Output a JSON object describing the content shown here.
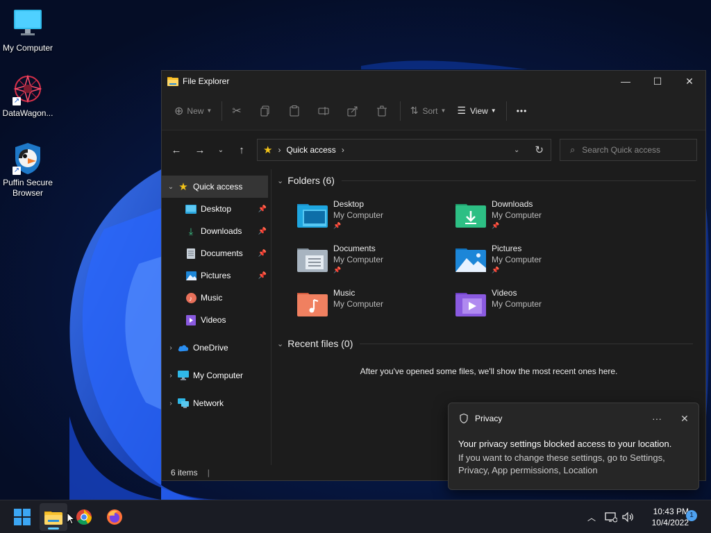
{
  "desktop": {
    "icons": [
      {
        "label": "My Computer",
        "icon": "monitor-icon"
      },
      {
        "label": "DataWagon...",
        "icon": "datawagon-icon"
      },
      {
        "label": "Puffin Secure Browser",
        "icon": "puffin-icon"
      }
    ]
  },
  "window": {
    "title": "File Explorer",
    "controls": {
      "minimize": "—",
      "maximize": "☐",
      "close": "✕"
    },
    "toolbar": {
      "new_label": "New",
      "sort_label": "Sort",
      "view_label": "View",
      "more_label": "•••"
    },
    "address": {
      "path": "Quick access",
      "search_placeholder": "Search Quick access"
    },
    "sidebar": {
      "items": [
        {
          "label": "Quick access",
          "icon": "star-icon",
          "pinned": false
        },
        {
          "label": "Desktop",
          "icon": "desktop-folder-icon",
          "pinned": true
        },
        {
          "label": "Downloads",
          "icon": "download-icon",
          "pinned": true
        },
        {
          "label": "Documents",
          "icon": "documents-icon",
          "pinned": true
        },
        {
          "label": "Pictures",
          "icon": "pictures-icon",
          "pinned": true
        },
        {
          "label": "Music",
          "icon": "music-icon",
          "pinned": false
        },
        {
          "label": "Videos",
          "icon": "videos-icon",
          "pinned": false
        },
        {
          "label": "OneDrive",
          "icon": "cloud-icon",
          "pinned": false
        },
        {
          "label": "My Computer",
          "icon": "monitor-icon",
          "pinned": false
        },
        {
          "label": "Network",
          "icon": "network-icon",
          "pinned": false
        }
      ]
    },
    "folders_header": "Folders (6)",
    "folders": [
      {
        "name": "Desktop",
        "location": "My Computer",
        "pinned": true,
        "icon": "desktop-folder-icon"
      },
      {
        "name": "Downloads",
        "location": "My Computer",
        "pinned": true,
        "icon": "downloads-folder-icon"
      },
      {
        "name": "Documents",
        "location": "My Computer",
        "pinned": true,
        "icon": "documents-folder-icon"
      },
      {
        "name": "Pictures",
        "location": "My Computer",
        "pinned": true,
        "icon": "pictures-folder-icon"
      },
      {
        "name": "Music",
        "location": "My Computer",
        "pinned": false,
        "icon": "music-folder-icon"
      },
      {
        "name": "Videos",
        "location": "My Computer",
        "pinned": false,
        "icon": "videos-folder-icon"
      }
    ],
    "recent_header": "Recent files (0)",
    "recent_empty": "After you've opened some files, we'll show the most recent ones here.",
    "status": "6 items"
  },
  "toast": {
    "title": "Privacy",
    "more": "···",
    "close": "✕",
    "message": "Your privacy settings blocked access to your location.",
    "detail": "If you want to change these settings, go to Settings, Privacy, App permissions, Location"
  },
  "taskbar": {
    "time": "10:43 PM",
    "date": "10/4/2022",
    "notifications": "1"
  },
  "colors": {
    "accent": "#60cdff",
    "window_bg": "#1c1c1c",
    "taskbar_bg": "#1a1c24"
  }
}
